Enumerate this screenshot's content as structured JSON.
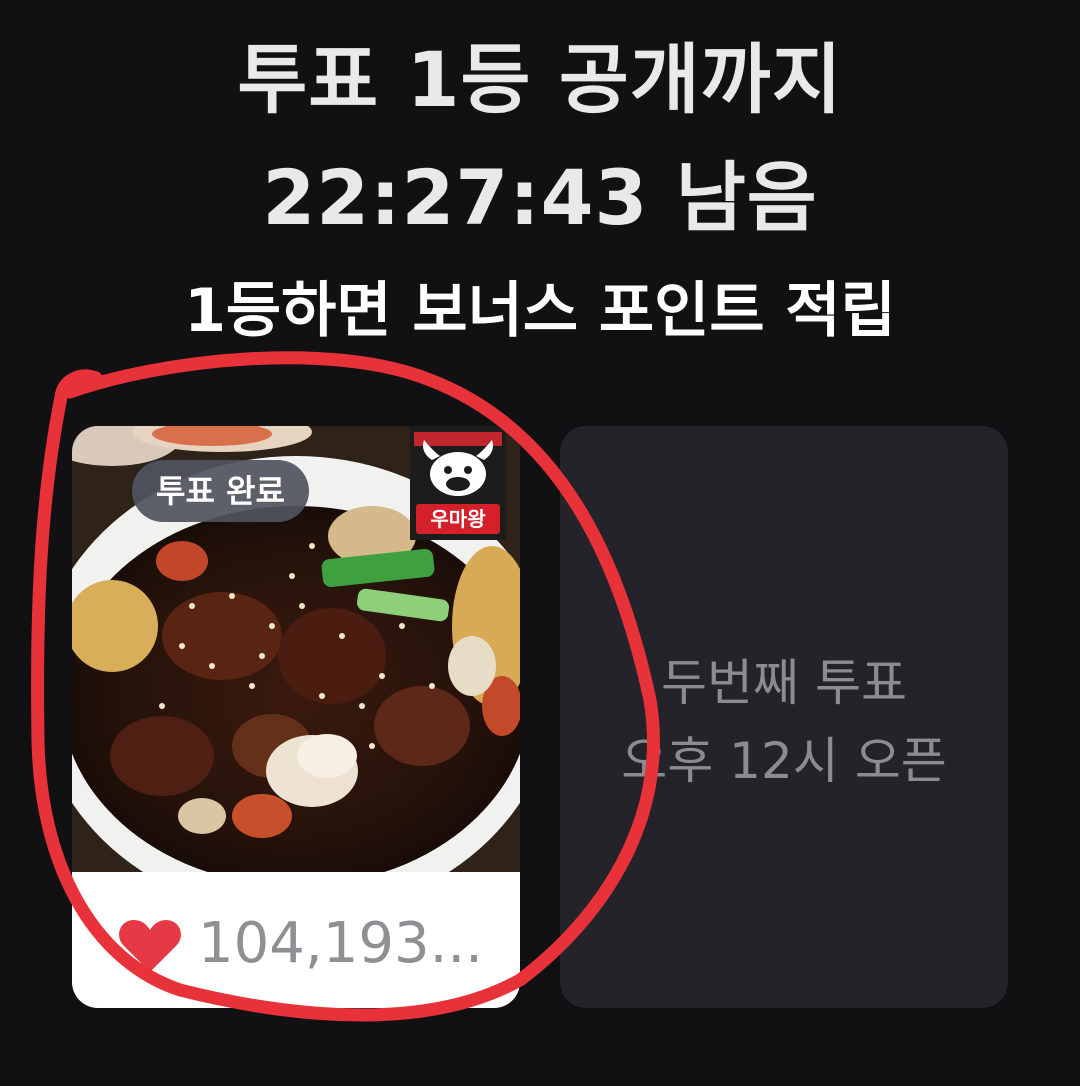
{
  "header": {
    "line1": "투표 1등 공개까지",
    "line2": "22:27:43 남음",
    "line3": "1등하면 보너스 포인트 적립"
  },
  "vote_card": {
    "badge": "투표 완료",
    "brand_name": "우마왕",
    "likes": "104,193...",
    "heart_icon": "heart-icon",
    "photo": "braised-chicken-dish-photo"
  },
  "locked_card": {
    "line1": "두번째 투표",
    "line2": "오후 12시 오픈"
  },
  "colors": {
    "background": "#111113",
    "annotation": "#e8323a",
    "heart": "#e53945",
    "locked_card": "#232329"
  }
}
